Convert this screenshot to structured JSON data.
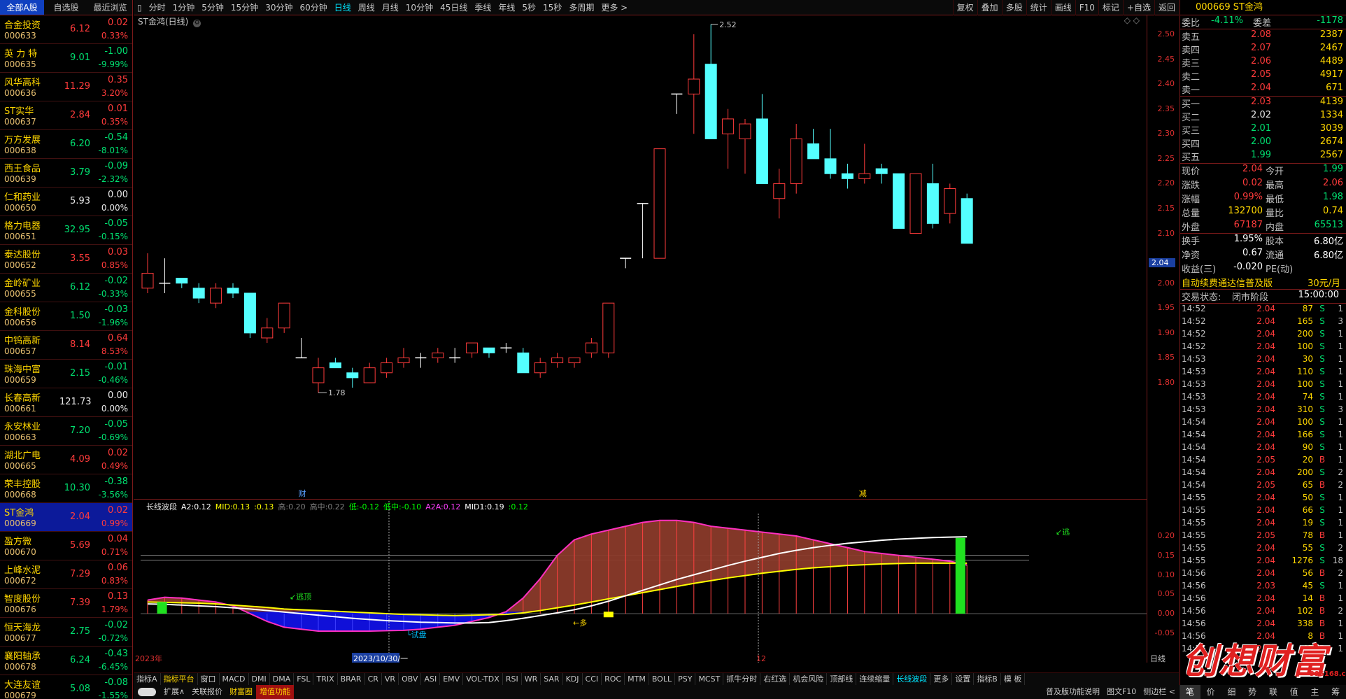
{
  "left_panel": {
    "tabs": [
      "全部A股",
      "自选股",
      "最近浏览"
    ],
    "stocks": [
      {
        "name": "合金投资",
        "code": "000633",
        "price": "6.12",
        "change": "0.02",
        "pct": "0.33%",
        "dir": "up"
      },
      {
        "name": "英 力 特",
        "code": "000635",
        "price": "9.01",
        "change": "-1.00",
        "pct": "-9.99%",
        "dir": "dn"
      },
      {
        "name": "风华高科",
        "code": "000636",
        "price": "11.29",
        "change": "0.35",
        "pct": "3.20%",
        "dir": "up"
      },
      {
        "name": "ST实华",
        "code": "000637",
        "price": "2.84",
        "change": "0.01",
        "pct": "0.35%",
        "dir": "up"
      },
      {
        "name": "万方发展",
        "code": "000638",
        "price": "6.20",
        "change": "-0.54",
        "pct": "-8.01%",
        "dir": "dn"
      },
      {
        "name": "西王食品",
        "code": "000639",
        "price": "3.79",
        "change": "-0.09",
        "pct": "-2.32%",
        "dir": "dn"
      },
      {
        "name": "仁和药业",
        "code": "000650",
        "price": "5.93",
        "change": "0.00",
        "pct": "0.00%",
        "dir": "eq"
      },
      {
        "name": "格力电器",
        "code": "000651",
        "price": "32.95",
        "change": "-0.05",
        "pct": "-0.15%",
        "dir": "dn"
      },
      {
        "name": "泰达股份",
        "code": "000652",
        "price": "3.55",
        "change": "0.03",
        "pct": "0.85%",
        "dir": "up"
      },
      {
        "name": "金岭矿业",
        "code": "000655",
        "price": "6.12",
        "change": "-0.02",
        "pct": "-0.33%",
        "dir": "dn"
      },
      {
        "name": "金科股份",
        "code": "000656",
        "price": "1.50",
        "change": "-0.03",
        "pct": "-1.96%",
        "dir": "dn"
      },
      {
        "name": "中钨高新",
        "code": "000657",
        "price": "8.14",
        "change": "0.64",
        "pct": "8.53%",
        "dir": "up"
      },
      {
        "name": "珠海中富",
        "code": "000659",
        "price": "2.15",
        "change": "-0.01",
        "pct": "-0.46%",
        "dir": "dn"
      },
      {
        "name": "长春高新",
        "code": "000661",
        "price": "121.73",
        "change": "0.00",
        "pct": "0.00%",
        "dir": "eq"
      },
      {
        "name": "永安林业",
        "code": "000663",
        "price": "7.20",
        "change": "-0.05",
        "pct": "-0.69%",
        "dir": "dn"
      },
      {
        "name": "湖北广电",
        "code": "000665",
        "price": "4.09",
        "change": "0.02",
        "pct": "0.49%",
        "dir": "up"
      },
      {
        "name": "荣丰控股",
        "code": "000668",
        "price": "10.30",
        "change": "-0.38",
        "pct": "-3.56%",
        "dir": "dn"
      },
      {
        "name": "ST金鸿",
        "code": "000669",
        "price": "2.04",
        "change": "0.02",
        "pct": "0.99%",
        "dir": "up",
        "selected": true
      },
      {
        "name": "盈方微",
        "code": "000670",
        "price": "5.69",
        "change": "0.04",
        "pct": "0.71%",
        "dir": "up"
      },
      {
        "name": "上峰水泥",
        "code": "000672",
        "price": "7.29",
        "change": "0.06",
        "pct": "0.83%",
        "dir": "up"
      },
      {
        "name": "智度股份",
        "code": "000676",
        "price": "7.39",
        "change": "0.13",
        "pct": "1.79%",
        "dir": "up"
      },
      {
        "name": "恒天海龙",
        "code": "000677",
        "price": "2.75",
        "change": "-0.02",
        "pct": "-0.72%",
        "dir": "dn"
      },
      {
        "name": "襄阳轴承",
        "code": "000678",
        "price": "6.24",
        "change": "-0.43",
        "pct": "-6.45%",
        "dir": "dn"
      },
      {
        "name": "大连友谊",
        "code": "000679",
        "price": "5.08",
        "change": "-0.08",
        "pct": "-1.55%",
        "dir": "dn"
      }
    ]
  },
  "toolbar": {
    "periods": [
      "分时",
      "1分钟",
      "5分钟",
      "15分钟",
      "30分钟",
      "60分钟",
      "日线",
      "周线",
      "月线",
      "10分钟",
      "45日线",
      "季线",
      "年线",
      "5秒",
      "15秒",
      "多周期",
      "更多 >"
    ],
    "active_period": "日线",
    "right": [
      "复权",
      "叠加",
      "多股",
      "统计",
      "画线",
      "F10",
      "标记",
      "+自选",
      "返回"
    ]
  },
  "main_chart": {
    "title": "ST金鸿(日线)",
    "high_label": "2.52",
    "low_label": "1.78",
    "event_label_1": "财",
    "event_label_2": "减",
    "current_price_tag": "2.04",
    "y_ticks": [
      "2.50",
      "2.45",
      "2.40",
      "2.35",
      "2.30",
      "2.25",
      "2.20",
      "2.15",
      "2.10",
      "2.00",
      "1.95",
      "1.90",
      "1.85",
      "1.80"
    ]
  },
  "chart_data": {
    "type": "candlestick",
    "ylim": [
      1.76,
      2.54
    ],
    "candles": [
      {
        "o": 1.99,
        "h": 2.06,
        "l": 1.98,
        "c": 2.02
      },
      {
        "o": 2.0,
        "h": 2.05,
        "l": 1.98,
        "c": 2.0
      },
      {
        "o": 2.01,
        "h": 2.01,
        "l": 1.99,
        "c": 2.0
      },
      {
        "o": 1.99,
        "h": 2.0,
        "l": 1.96,
        "c": 1.97
      },
      {
        "o": 1.96,
        "h": 2.0,
        "l": 1.95,
        "c": 1.99
      },
      {
        "o": 1.99,
        "h": 2.0,
        "l": 1.97,
        "c": 1.98
      },
      {
        "o": 1.98,
        "h": 1.98,
        "l": 1.89,
        "c": 1.9
      },
      {
        "o": 1.89,
        "h": 1.93,
        "l": 1.88,
        "c": 1.91
      },
      {
        "o": 1.91,
        "h": 1.96,
        "l": 1.9,
        "c": 1.96
      },
      {
        "o": 1.85,
        "h": 1.89,
        "l": 1.85,
        "c": 1.85
      },
      {
        "o": 1.8,
        "h": 1.85,
        "l": 1.78,
        "c": 1.83
      },
      {
        "o": 1.84,
        "h": 1.85,
        "l": 1.83,
        "c": 1.83
      },
      {
        "o": 1.82,
        "h": 1.83,
        "l": 1.79,
        "c": 1.81
      },
      {
        "o": 1.8,
        "h": 1.84,
        "l": 1.8,
        "c": 1.83
      },
      {
        "o": 1.82,
        "h": 1.85,
        "l": 1.81,
        "c": 1.84
      },
      {
        "o": 1.84,
        "h": 1.87,
        "l": 1.83,
        "c": 1.85
      },
      {
        "o": 1.85,
        "h": 1.86,
        "l": 1.83,
        "c": 1.85
      },
      {
        "o": 1.85,
        "h": 1.87,
        "l": 1.84,
        "c": 1.86
      },
      {
        "o": 1.85,
        "h": 1.87,
        "l": 1.84,
        "c": 1.85
      },
      {
        "o": 1.86,
        "h": 1.88,
        "l": 1.85,
        "c": 1.88
      },
      {
        "o": 1.87,
        "h": 1.87,
        "l": 1.85,
        "c": 1.86
      },
      {
        "o": 1.87,
        "h": 1.88,
        "l": 1.86,
        "c": 1.87
      },
      {
        "o": 1.86,
        "h": 1.87,
        "l": 1.82,
        "c": 1.82
      },
      {
        "o": 1.82,
        "h": 1.85,
        "l": 1.81,
        "c": 1.84
      },
      {
        "o": 1.84,
        "h": 1.86,
        "l": 1.83,
        "c": 1.85
      },
      {
        "o": 1.84,
        "h": 1.85,
        "l": 1.83,
        "c": 1.85
      },
      {
        "o": 1.86,
        "h": 1.89,
        "l": 1.85,
        "c": 1.88
      },
      {
        "o": 1.86,
        "h": 1.96,
        "l": 1.85,
        "c": 1.96
      },
      {
        "o": 2.05,
        "h": 2.05,
        "l": 2.03,
        "c": 2.05
      },
      {
        "o": 2.16,
        "h": 2.16,
        "l": 2.05,
        "c": 2.16
      },
      {
        "o": 2.05,
        "h": 2.27,
        "l": 2.05,
        "c": 2.27
      },
      {
        "o": 2.38,
        "h": 2.38,
        "l": 2.34,
        "c": 2.38
      },
      {
        "o": 2.38,
        "h": 2.5,
        "l": 2.3,
        "c": 2.41
      },
      {
        "o": 2.44,
        "h": 2.52,
        "l": 2.29,
        "c": 2.29
      },
      {
        "o": 2.3,
        "h": 2.35,
        "l": 2.23,
        "c": 2.33
      },
      {
        "o": 2.29,
        "h": 2.33,
        "l": 2.22,
        "c": 2.32
      },
      {
        "o": 2.33,
        "h": 2.38,
        "l": 2.2,
        "c": 2.2
      },
      {
        "o": 2.17,
        "h": 2.23,
        "l": 2.13,
        "c": 2.2
      },
      {
        "o": 2.2,
        "h": 2.32,
        "l": 2.18,
        "c": 2.29
      },
      {
        "o": 2.28,
        "h": 2.31,
        "l": 2.25,
        "c": 2.25
      },
      {
        "o": 2.25,
        "h": 2.31,
        "l": 2.21,
        "c": 2.22
      },
      {
        "o": 2.22,
        "h": 2.24,
        "l": 2.19,
        "c": 2.21
      },
      {
        "o": 2.21,
        "h": 2.28,
        "l": 2.2,
        "c": 2.22
      },
      {
        "o": 2.23,
        "h": 2.24,
        "l": 2.2,
        "c": 2.22
      },
      {
        "o": 2.22,
        "h": 2.22,
        "l": 2.11,
        "c": 2.11
      },
      {
        "o": 2.1,
        "h": 2.22,
        "l": 2.1,
        "c": 2.22
      },
      {
        "o": 2.2,
        "h": 2.24,
        "l": 2.11,
        "c": 2.12
      },
      {
        "o": 2.14,
        "h": 2.2,
        "l": 2.12,
        "c": 2.19
      },
      {
        "o": 2.17,
        "h": 2.18,
        "l": 2.08,
        "c": 2.08
      }
    ]
  },
  "indicator": {
    "name": "长线波段",
    "items": [
      {
        "label": "A2:",
        "value": "0.12",
        "color": "#ffffff"
      },
      {
        "label": "MID:",
        "value": "0.13",
        "color": "#ffff00"
      },
      {
        "label": ":",
        "value": "0.13",
        "color": "#ffff00"
      },
      {
        "label": "高:",
        "value": "0.20",
        "color": "#808080"
      },
      {
        "label": "高中:",
        "value": "0.22",
        "color": "#808080"
      },
      {
        "label": "低:",
        "value": "-0.12",
        "color": "#00ff00"
      },
      {
        "label": "低中:",
        "value": "-0.10",
        "color": "#00ff00"
      },
      {
        "label": "A2A:",
        "value": "0.12",
        "color": "#ff40ff"
      },
      {
        "label": "MID1:",
        "value": "0.19",
        "color": "#ffffff"
      },
      {
        "label": ":",
        "value": "0.12",
        "color": "#00ff00"
      }
    ],
    "y_ticks": [
      "0.20",
      "0.15",
      "0.10",
      "0.05",
      "0.00",
      "-0.05"
    ],
    "labels": {
      "top": "逃顶",
      "bottom": "试盘",
      "buy": "多",
      "right": "逃"
    },
    "date_left": "2023年",
    "date_cursor": "2023/10/30/一",
    "date_right": "12",
    "period_label": "日线"
  },
  "bottom_bar_1": [
    "指标A",
    "指标平台",
    "窗口",
    "MACD",
    "DMI",
    "DMA",
    "FSL",
    "TRIX",
    "BRAR",
    "CR",
    "VR",
    "OBV",
    "ASI",
    "EMV",
    "VOL-TDX",
    "RSI",
    "WR",
    "SAR",
    "KDJ",
    "CCI",
    "ROC",
    "MTM",
    "BOLL",
    "PSY",
    "MCST",
    "抓牛分时",
    "右红选",
    "机会风险",
    "顶部线",
    "连续缩量",
    "长线波段",
    "更多",
    "设置",
    "指标B",
    "模 板"
  ],
  "bottom_bar_2": {
    "left": [
      "扩展∧",
      "关联报价",
      "财富圈",
      "增值功能"
    ],
    "right": [
      "普及版功能说明",
      "图文F10",
      "侧边栏 <"
    ]
  },
  "right_panel": {
    "code": "000669",
    "name": "ST金鸿",
    "wei_bi_label": "委比",
    "wei_bi": "-4.11%",
    "wei_cha_label": "委差",
    "wei_cha": "-1178",
    "asks": [
      {
        "label": "卖五",
        "price": "2.08",
        "vol": "2387"
      },
      {
        "label": "卖四",
        "price": "2.07",
        "vol": "2467"
      },
      {
        "label": "卖三",
        "price": "2.06",
        "vol": "4489"
      },
      {
        "label": "卖二",
        "price": "2.05",
        "vol": "4917"
      },
      {
        "label": "卖一",
        "price": "2.04",
        "vol": "671"
      }
    ],
    "bids": [
      {
        "label": "买一",
        "price": "2.03",
        "vol": "4139"
      },
      {
        "label": "买二",
        "price": "2.02",
        "vol": "1334"
      },
      {
        "label": "买三",
        "price": "2.01",
        "vol": "3039"
      },
      {
        "label": "买四",
        "price": "2.00",
        "vol": "2674"
      },
      {
        "label": "买五",
        "price": "1.99",
        "vol": "2567"
      }
    ],
    "quotes": [
      {
        "l1": "现价",
        "v1": "2.04",
        "l2": "今开",
        "v2": "1.99",
        "c1": "up",
        "c2": "dn"
      },
      {
        "l1": "涨跌",
        "v1": "0.02",
        "l2": "最高",
        "v2": "2.06",
        "c1": "up",
        "c2": "up"
      },
      {
        "l1": "涨幅",
        "v1": "0.99%",
        "l2": "最低",
        "v2": "1.98",
        "c1": "up",
        "c2": "dn"
      },
      {
        "l1": "总量",
        "v1": "132700",
        "l2": "量比",
        "v2": "0.74",
        "c1": "y",
        "c2": "y"
      },
      {
        "l1": "外盘",
        "v1": "67187",
        "l2": "内盘",
        "v2": "65513",
        "c1": "up",
        "c2": "dn"
      },
      {
        "l1": "换手",
        "v1": "1.95%",
        "l2": "股本",
        "v2": "6.80亿",
        "c1": "w",
        "c2": "w"
      },
      {
        "l1": "净资",
        "v1": "0.67",
        "l2": "流通",
        "v2": "6.80亿",
        "c1": "w",
        "c2": "w"
      },
      {
        "l1": "收益(三)",
        "v1": "-0.020",
        "l2": "PE(动)",
        "v2": "",
        "c1": "w",
        "c2": "w"
      }
    ],
    "promo_text": "自动续费通达信普及版",
    "promo_price": "30元/月",
    "status_label": "交易状态:",
    "status_value": "闭市阶段",
    "status_time": "15:00:00",
    "ticks": [
      {
        "t": "14:52",
        "p": "2.04",
        "v": "87",
        "f": "S",
        "n": "1"
      },
      {
        "t": "14:52",
        "p": "2.04",
        "v": "165",
        "f": "S",
        "n": "3"
      },
      {
        "t": "14:52",
        "p": "2.04",
        "v": "200",
        "f": "S",
        "n": "1"
      },
      {
        "t": "14:52",
        "p": "2.04",
        "v": "100",
        "f": "S",
        "n": "1"
      },
      {
        "t": "14:53",
        "p": "2.04",
        "v": "30",
        "f": "S",
        "n": "1"
      },
      {
        "t": "14:53",
        "p": "2.04",
        "v": "110",
        "f": "S",
        "n": "1"
      },
      {
        "t": "14:53",
        "p": "2.04",
        "v": "100",
        "f": "S",
        "n": "1"
      },
      {
        "t": "14:53",
        "p": "2.04",
        "v": "74",
        "f": "S",
        "n": "1"
      },
      {
        "t": "14:53",
        "p": "2.04",
        "v": "310",
        "f": "S",
        "n": "3"
      },
      {
        "t": "14:54",
        "p": "2.04",
        "v": "100",
        "f": "S",
        "n": "1"
      },
      {
        "t": "14:54",
        "p": "2.04",
        "v": "166",
        "f": "S",
        "n": "1"
      },
      {
        "t": "14:54",
        "p": "2.04",
        "v": "90",
        "f": "S",
        "n": "1"
      },
      {
        "t": "14:54",
        "p": "2.05",
        "v": "20",
        "f": "B",
        "n": "1"
      },
      {
        "t": "14:54",
        "p": "2.04",
        "v": "200",
        "f": "S",
        "n": "2"
      },
      {
        "t": "14:54",
        "p": "2.05",
        "v": "65",
        "f": "B",
        "n": "2"
      },
      {
        "t": "14:55",
        "p": "2.04",
        "v": "50",
        "f": "S",
        "n": "1"
      },
      {
        "t": "14:55",
        "p": "2.04",
        "v": "66",
        "f": "S",
        "n": "1"
      },
      {
        "t": "14:55",
        "p": "2.04",
        "v": "19",
        "f": "S",
        "n": "1"
      },
      {
        "t": "14:55",
        "p": "2.05",
        "v": "78",
        "f": "B",
        "n": "1"
      },
      {
        "t": "14:55",
        "p": "2.04",
        "v": "55",
        "f": "S",
        "n": "2"
      },
      {
        "t": "14:55",
        "p": "2.04",
        "v": "1276",
        "f": "S",
        "n": "18"
      },
      {
        "t": "14:56",
        "p": "2.04",
        "v": "56",
        "f": "B",
        "n": "2"
      },
      {
        "t": "14:56",
        "p": "2.03",
        "v": "45",
        "f": "S",
        "n": "1"
      },
      {
        "t": "14:56",
        "p": "2.04",
        "v": "14",
        "f": "B",
        "n": "1"
      },
      {
        "t": "14:56",
        "p": "2.04",
        "v": "102",
        "f": "B",
        "n": "2"
      },
      {
        "t": "14:56",
        "p": "2.04",
        "v": "338",
        "f": "B",
        "n": "1"
      },
      {
        "t": "14:56",
        "p": "2.04",
        "v": "8",
        "f": "B",
        "n": "1"
      },
      {
        "t": "14:56",
        "p": "2.04",
        "v": "45",
        "f": "B",
        "n": "1"
      }
    ],
    "tabs": [
      "笔",
      "价",
      "细",
      "势",
      "联",
      "值",
      "主",
      "筹"
    ]
  },
  "watermark": {
    "text": "创想财富",
    "url": "995168.cn"
  }
}
